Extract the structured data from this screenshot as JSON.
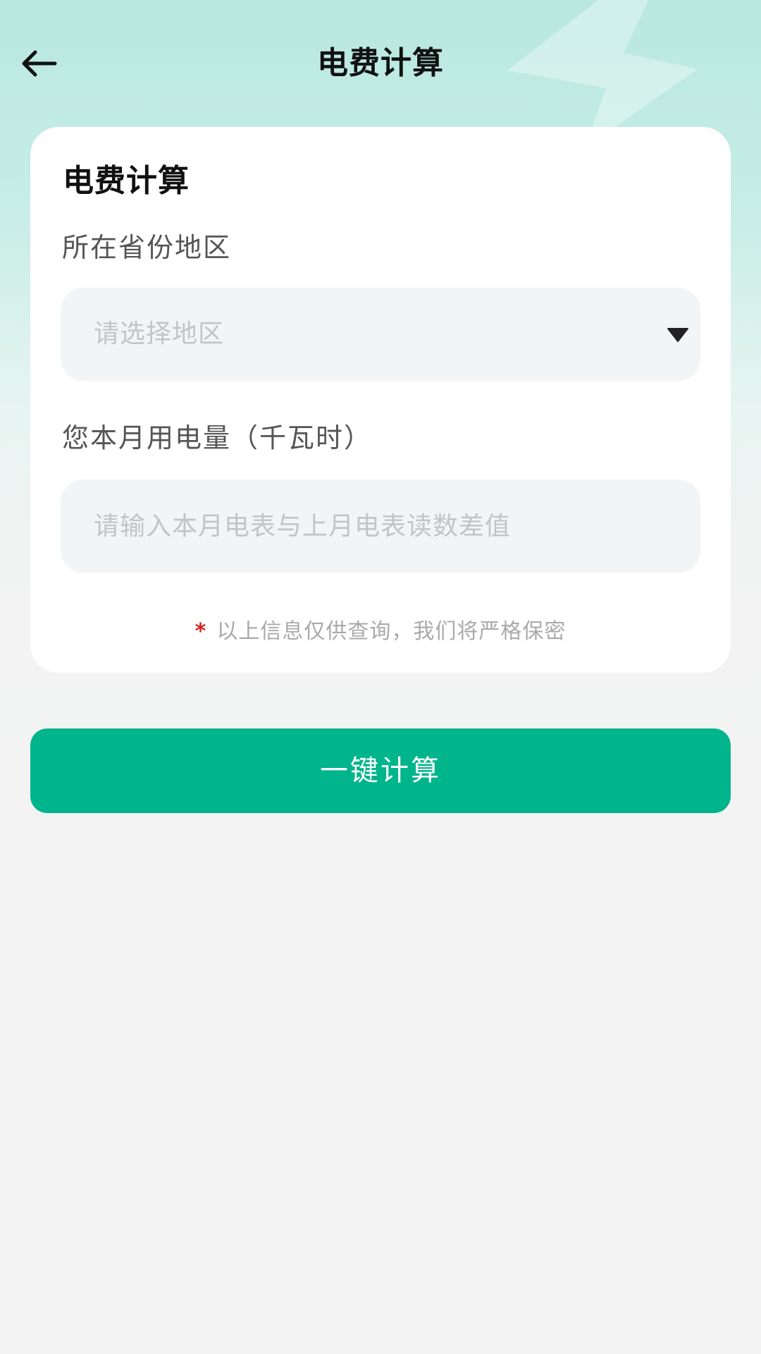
{
  "header": {
    "title": "电费计算"
  },
  "form": {
    "title": "电费计算",
    "region_label": "所在省份地区",
    "region_placeholder": "请选择地区",
    "usage_label": "您本月用电量（千瓦时）",
    "usage_placeholder": "请输入本月电表与上月电表读数差值",
    "notice_star": "*",
    "notice_text": "以上信息仅供查询，我们将严格保密"
  },
  "actions": {
    "calculate_label": "一键计算"
  },
  "colors": {
    "accent": "#00b48c",
    "header_bg": "#b8e8e0",
    "page_bg": "#f3f3f3",
    "notice_star": "#d62424"
  },
  "icons": {
    "back": "arrow-left-icon",
    "dropdown": "caret-down-icon",
    "background_decoration": "lightning-bolt-icon"
  }
}
